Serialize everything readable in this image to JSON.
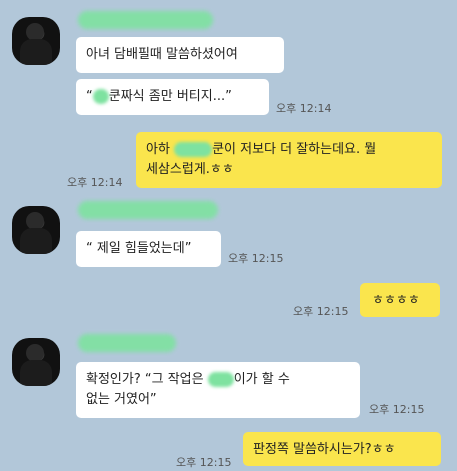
{
  "chat": {
    "messages": [
      {
        "text": "아녀 담배필때 말씀하셨어여"
      },
      {
        "text_prefix": "“",
        "text_suffix": "쿤짜식 좀만 버티지...”",
        "time": "오후 12:14"
      },
      {
        "text_l1_prefix": "아하 ",
        "text_l1_suffix": "쿤이 저보다 더 잘하는데요. 뭘",
        "text_l2": "세삼스럽게.ㅎㅎ",
        "time": "오후 12:14"
      },
      {
        "text": "“ 제일 힘들었는데”",
        "time": "오후 12:15"
      },
      {
        "text": "ㅎㅎㅎㅎ",
        "time": "오후 12:15"
      },
      {
        "text_l1_prefix": "확정인가? “그 작업은 ",
        "text_l1_suffix": "이가 할 수",
        "text_l2": "없는 거였어”",
        "time": "오후 12:15"
      },
      {
        "text": "판정쪽 말씀하시는가?ㅎㅎ",
        "time": "오후 12:15"
      }
    ]
  },
  "colors": {
    "background": "#b2c7d9",
    "incoming_bubble": "#ffffff",
    "outgoing_bubble": "#fae54d",
    "redaction": "#7ee2a0"
  }
}
